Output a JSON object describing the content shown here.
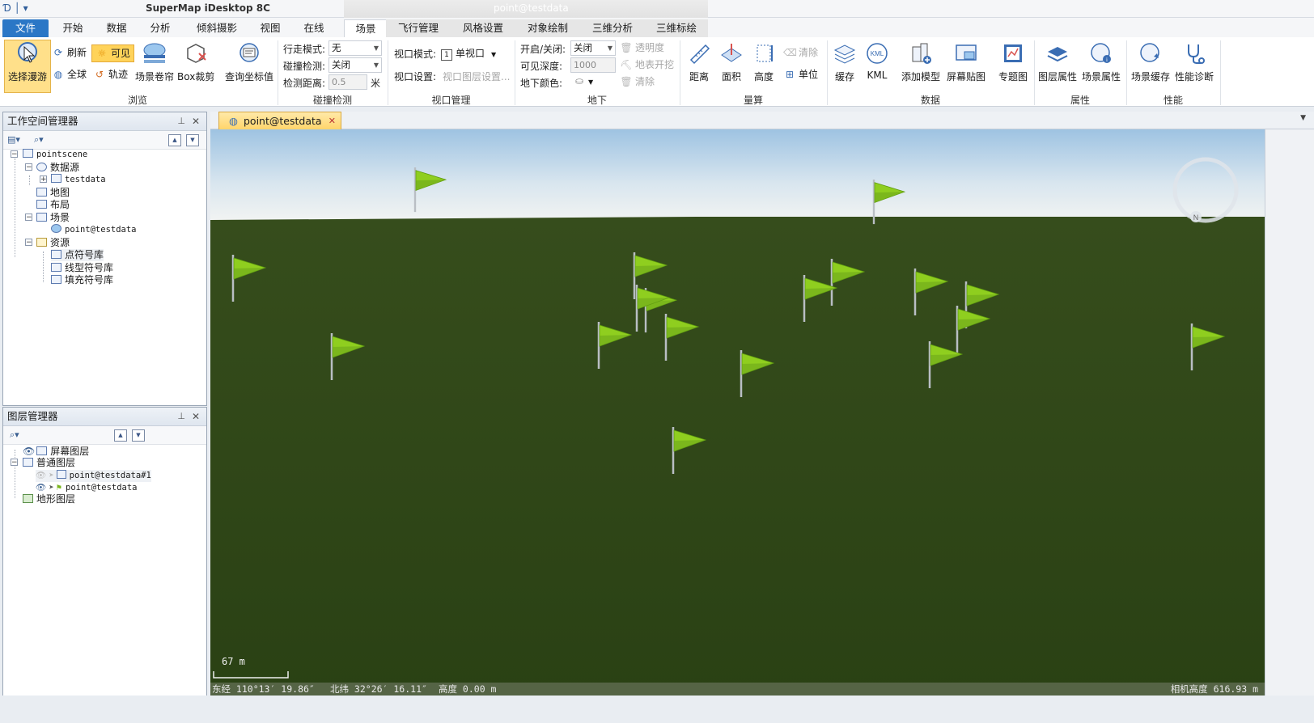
{
  "titlebar": {
    "app_title": "SuperMap iDesktop 8C",
    "context_title": "point@testdata"
  },
  "tabs": [
    "文件",
    "开始",
    "数据",
    "分析",
    "倾斜摄影",
    "视图",
    "在线",
    "场景",
    "飞行管理",
    "风格设置",
    "对象绘制",
    "三维分析",
    "三维标绘"
  ],
  "active_tab": "场景",
  "ribbon": {
    "browse": {
      "group_label": "浏览",
      "select_roam": "选择漫游",
      "refresh": "刷新",
      "visible": "可见",
      "globe": "全球",
      "track": "轨迹",
      "scene_curtain": "场景卷帘",
      "box_clip": "Box裁剪",
      "query_coord": "查询坐标值"
    },
    "collision": {
      "group_label": "碰撞检测",
      "walk_mode_label": "行走模式:",
      "walk_mode_value": "无",
      "collision_label": "碰撞检测:",
      "collision_value": "关闭",
      "distance_label": "检测距离:",
      "distance_value": "0.5",
      "distance_unit": "米"
    },
    "viewport": {
      "group_label": "视口管理",
      "mode_label": "视口模式:",
      "mode_value": "单视口",
      "mode_badge": "1",
      "settings_label": "视口设置:",
      "layer_settings": "视口图层设置..."
    },
    "underground": {
      "group_label": "地下",
      "toggle_label": "开启/关闭:",
      "toggle_value": "关闭",
      "depth_label": "可见深度:",
      "depth_value": "1000",
      "color_label": "地下颜色:",
      "transparency": "透明度",
      "surface_dig": "地表开挖",
      "clear": "清除"
    },
    "measure": {
      "group_label": "量算",
      "distance": "距离",
      "area": "面积",
      "height": "高度",
      "clear": "清除",
      "unit": "单位"
    },
    "data": {
      "group_label": "数据",
      "cache": "缓存",
      "kml": "KML",
      "add_model": "添加模型",
      "screen_overlay": "屏幕贴图",
      "thematic": "专题图"
    },
    "props": {
      "group_label": "属性",
      "layer_props": "图层属性",
      "scene_props": "场景属性"
    },
    "perf": {
      "group_label": "性能",
      "scene_cache": "场景缓存",
      "diagnosis": "性能诊断"
    }
  },
  "workspace": {
    "title": "工作空间管理器",
    "tree": {
      "root": "pointscene",
      "datasource": "数据源",
      "testdata": "testdata",
      "map": "地图",
      "layout": "布局",
      "scene": "场景",
      "scene_item": "point@testdata",
      "resources": "资源",
      "point_symbols": "点符号库",
      "line_symbols": "线型符号库",
      "fill_symbols": "填充符号库"
    }
  },
  "layers": {
    "title": "图层管理器",
    "tree": {
      "screen_layers": "屏幕图层",
      "normal_layers": "普通图层",
      "layer1": "point@testdata#1",
      "layer2": "point@testdata",
      "terrain_layers": "地形图层"
    }
  },
  "document_tab": "point@testdata",
  "scene": {
    "scale_label": "67 m",
    "status_lon": "东经 110°13′ 19.86″",
    "status_lat": "北纬 32°26′ 16.11″",
    "status_alt": "高度 0.00 m",
    "status_cam": "相机高度 616.93 m",
    "compass_letter": "N"
  },
  "colors": {
    "accent": "#2b77c6",
    "flag": "#8fce1f",
    "ground": "#2d4416",
    "sky_top": "#9ec3e2"
  }
}
